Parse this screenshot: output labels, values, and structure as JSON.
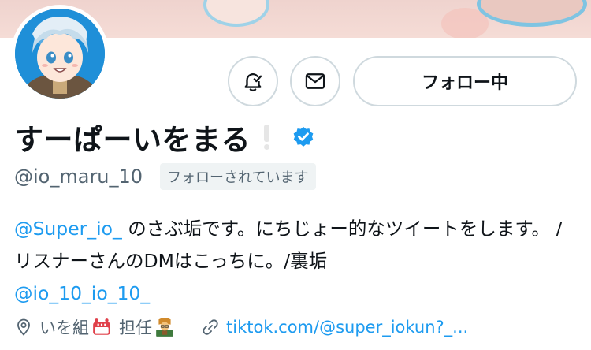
{
  "profile": {
    "display_name": "すーぱーいをまる",
    "handle": "@io_maru_10",
    "follows_you_badge": "フォローされています",
    "verified": true
  },
  "actions": {
    "follow_label": "フォロー中",
    "notify_icon": "bell-check-icon",
    "message_icon": "mail-icon"
  },
  "bio": {
    "mention_1": "@Super_io_",
    "text_1": " のさぶ垢です。にちじょー的なツイートをします。 / リスナーさんのDMはこっちに。/裏垢",
    "mention_2": "@io_10_io_10_"
  },
  "meta": {
    "location": "いを組",
    "location_suffix": "担任",
    "location_emojis": [
      "alarm-clock-icon",
      "teacher-icon"
    ],
    "website": "tiktok.com/@super_iokun?_..."
  },
  "colors": {
    "accent": "#1d9bf0",
    "secondary_text": "#536471",
    "border": "#cfd9de"
  }
}
